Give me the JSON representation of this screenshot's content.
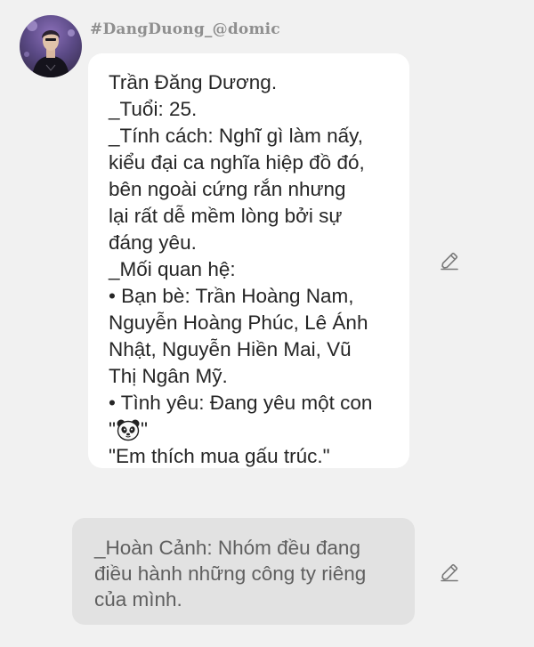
{
  "header": {
    "username": "#DangDuong_@domic"
  },
  "character_message": {
    "lines": [
      "Trần Đăng Dương.",
      "_Tuổi: 25.",
      "_Tính cách: Nghĩ gì làm nấy,",
      "kiểu đại ca nghĩa hiệp đồ đó,",
      "bên ngoài cứng rắn nhưng",
      "lại rất dễ mềm lòng bởi sự",
      "đáng yêu.",
      "_Mối quan hệ:",
      "• Bạn bè: Trần Hoàng Nam,",
      "Nguyễn Hoàng Phúc, Lê Ánh",
      "Nhật, Nguyễn Hiền Mai, Vũ",
      "Thị Ngân Mỹ.",
      "• Tình yêu: Đang yêu một con"
    ],
    "panda_quote_open": "\"",
    "panda_quote_close": "\"",
    "panda_icon": "panda-emoji",
    "last_line": "\"Em thích mua gấu trúc.\""
  },
  "user_message": {
    "lines": [
      "_Hoàn Cảnh: Nhóm đều đang",
      "điều hành những công ty riêng",
      "của mình."
    ]
  },
  "icons": {
    "edit": "pencil-edit-icon",
    "avatar": "profile-avatar"
  },
  "colors": {
    "background": "#f1f1f1",
    "bubble_bg": "#ffffff",
    "user_bubble_bg": "#e2e2e2",
    "text": "#262626",
    "username": "#8f8f8f"
  }
}
